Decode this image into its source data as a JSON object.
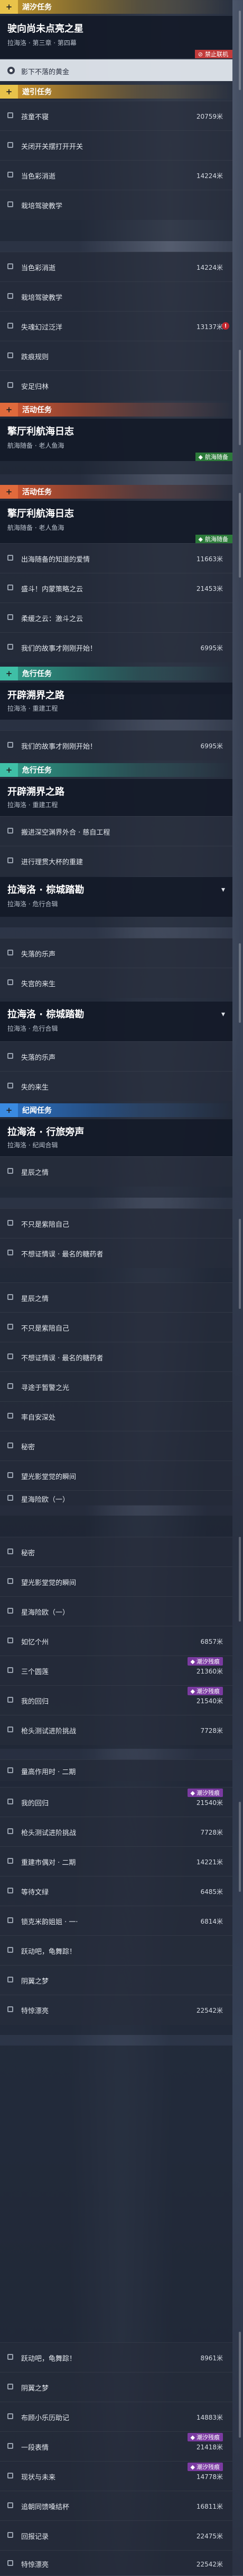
{
  "categories": {
    "main": "湖汐任务",
    "side1": "遊引任务",
    "event1": "活动任务",
    "event2": "活动任务",
    "daily1": "危行任务",
    "daily2": "危行任务",
    "bond": "纪闻任务"
  },
  "quests": {
    "q1": {
      "title": "驶向尚未点亮之星",
      "sub": "拉海洛 · 第三章 · 第四幕",
      "flag": "禁止联机"
    },
    "q2": {
      "title": "擎厅利航海日志",
      "sub": "航海随备 · 老人鱼海",
      "flag": "航海随备"
    },
    "q3": {
      "title": "擎厅利航海日志",
      "sub": "航海随备 · 老人鱼海",
      "flag": "航海随备"
    },
    "q4": {
      "title": "开辟溯界之路",
      "sub": "拉海洛 · 重建工程"
    },
    "q5": {
      "title": "开辟溯界之路",
      "sub": "拉海洛 · 重建工程"
    },
    "q6": {
      "title": "拉海洛 · 棕城踏勘",
      "sub": "拉海洛 · 危行合辑"
    },
    "q7": {
      "title": "拉海洛 · 棕城踏勘",
      "sub": "拉海洛 · 危行合辑"
    },
    "q8": {
      "title": "拉海洛 · 行旅旁声",
      "sub": "拉海洛 · 纪闻合辑"
    }
  },
  "objectives": {
    "o1": {
      "label": "影下不落的黄金",
      "dist": ""
    },
    "o2": {
      "label": "孩童不寝",
      "dist": "20759米"
    },
    "o3": {
      "label": "关闭开关摆打开开关",
      "dist": ""
    },
    "o4": {
      "label": "当色彩消逝",
      "dist": "14224米"
    },
    "o5": {
      "label": "栽培驾驶教学",
      "dist": ""
    },
    "o6": {
      "label": "当色彩消逝",
      "dist": "14224米"
    },
    "o7": {
      "label": "栽培驾驶教学",
      "dist": ""
    },
    "o8": {
      "label": "失魂幻过泛洋",
      "dist": "13137米"
    },
    "o9": {
      "label": "跌痕规则",
      "dist": ""
    },
    "o10": {
      "label": "安足归林",
      "dist": ""
    },
    "o11": {
      "label": "出海随备的知道的爱情",
      "dist": "11663米"
    },
    "o12": {
      "label": "盛斗！内蒙策略之云",
      "dist": "21453米"
    },
    "o13": {
      "label": "柔缓之云：激斗之云",
      "dist": ""
    },
    "o14": {
      "label": "我们的故事才刚刚开始！",
      "dist": "6995米"
    },
    "o15": {
      "label": "我们的故事才刚刚开始！",
      "dist": "6995米"
    },
    "o16": {
      "label": "搬进深空渊界外合 · 慈自工程",
      "dist": ""
    },
    "o17": {
      "label": "进行理贯大杯的重建",
      "dist": ""
    },
    "o18": {
      "label": "失落的乐声",
      "dist": ""
    },
    "o19": {
      "label": "失宫的来生",
      "dist": ""
    },
    "o20": {
      "label": "失落的乐声",
      "dist": ""
    },
    "o21": {
      "label": "失的来生",
      "dist": ""
    },
    "o22": {
      "label": "星辰之情",
      "dist": ""
    },
    "o23": {
      "label": "不只是紫陪自己",
      "dist": ""
    },
    "o24": {
      "label": "不想证情误 · 最名的糖药者",
      "dist": ""
    },
    "o25": {
      "label": "星辰之情",
      "dist": ""
    },
    "o26": {
      "label": "不只是紫陪自己",
      "dist": ""
    },
    "o27": {
      "label": "不想证情误 · 最名的糖药者",
      "dist": ""
    },
    "o28": {
      "label": "寻途于暂警之光",
      "dist": ""
    },
    "o29": {
      "label": "率自安深处",
      "dist": ""
    },
    "o30": {
      "label": "秘密",
      "dist": ""
    },
    "o31": {
      "label": "望光影堂觉的瞬间",
      "dist": ""
    },
    "o32": {
      "label": "星海险欧（一）",
      "dist": ""
    },
    "o33": {
      "label": "秘密",
      "dist": ""
    },
    "o34": {
      "label": "望光影堂觉的瞬间",
      "dist": ""
    },
    "o35": {
      "label": "星海险欧（一）",
      "dist": ""
    },
    "o36": {
      "label": "如忆个州",
      "dist": "6857米"
    },
    "o37": {
      "label": "三个圆莲",
      "dist": "21360米",
      "tag": "潮汐残痕"
    },
    "o38": {
      "label": "我的回归",
      "dist": "21540米",
      "tag": "潮汐残痕"
    },
    "o39": {
      "label": "枪头测试进阶挑战",
      "dist": "7728米"
    },
    "o40": {
      "label": "量高作用时 · 二期",
      "dist": ""
    },
    "o41": {
      "label": "我的回归",
      "dist": "21540米",
      "tag": "潮汐残痕"
    },
    "o42": {
      "label": "枪头测试进阶挑战",
      "dist": "7728米"
    },
    "o43": {
      "label": "重建市偶对 · 二期",
      "dist": "14221米"
    },
    "o44": {
      "label": "等待文绿",
      "dist": "6485米"
    },
    "o45": {
      "label": "锁克米韵姐姐 · 一·",
      "dist": "6814米"
    },
    "o46": {
      "label": "跃动吧，龟舞踪！",
      "dist": ""
    },
    "o47": {
      "label": "阴翼之梦",
      "dist": ""
    },
    "o48": {
      "label": "特惊漂亮",
      "dist": "22542米"
    },
    "o49": {
      "label": "跃动吧，龟舞踪！",
      "dist": "8961米"
    },
    "o50": {
      "label": "阴翼之梦",
      "dist": ""
    },
    "o51": {
      "label": "布顾小乐历助记",
      "dist": "14883米"
    },
    "o52": {
      "label": "一段表情",
      "dist": "21418米",
      "tag": "潮汐残痕"
    },
    "o53": {
      "label": "现状与未来",
      "dist": "14778米",
      "tag": "潮汐残痕"
    },
    "o54": {
      "label": "追朝同馈嗓结杯",
      "dist": "16811米"
    },
    "o55": {
      "label": "回报记录",
      "dist": "22475米"
    },
    "o56": {
      "label": "特惊漂亮",
      "dist": "22542米"
    }
  },
  "icons": {
    "plus": "+",
    "chevron": "▾",
    "tag_mark": "◆",
    "alert": "!"
  },
  "colors": {
    "main": "#e8c24a",
    "event": "#d8572f",
    "daily": "#2f9f8a",
    "bond": "#2a73c9"
  }
}
